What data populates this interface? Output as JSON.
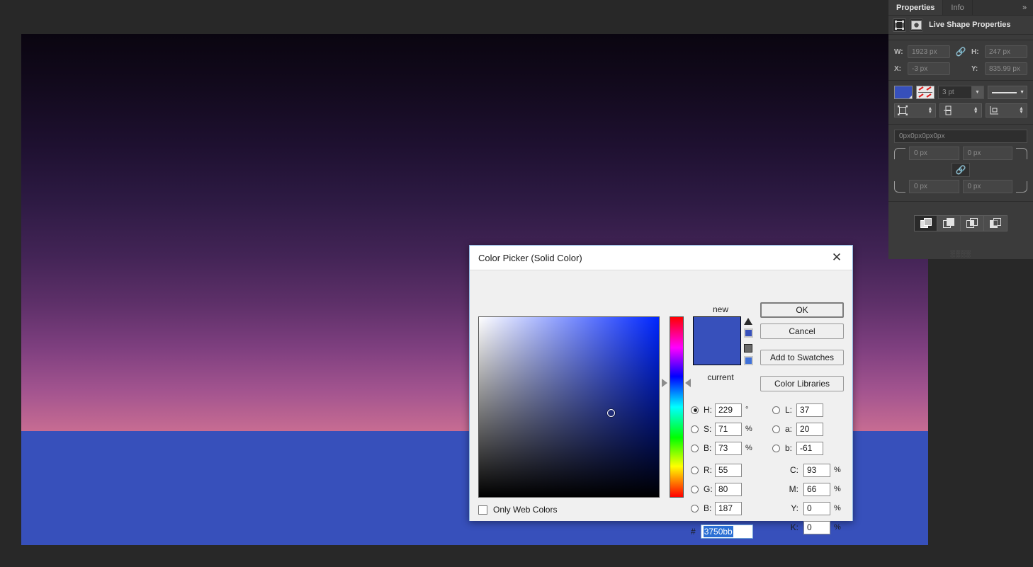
{
  "canvas": {
    "gradient_top_color": "#0a0510",
    "gradient_bottom_color": "#c76c92",
    "shape_color": "#3750bb"
  },
  "properties_panel": {
    "tabs": [
      {
        "label": "Properties",
        "active": true
      },
      {
        "label": "Info",
        "active": false
      }
    ],
    "collapse_icon": "»",
    "title": "Live Shape Properties",
    "dimensions": {
      "w_label": "W:",
      "w_value": "1923 px",
      "h_label": "H:",
      "h_value": "247 px",
      "x_label": "X:",
      "x_value": "-3 px",
      "y_label": "Y:",
      "y_value": "835.99 px",
      "link_icon": "🔗"
    },
    "stroke": {
      "fill_color": "#3750bb",
      "stroke_width": "3 pt"
    },
    "corner_radius": {
      "combined": "0px0px0px0px",
      "top_left": "0 px",
      "top_right": "0 px",
      "bottom_left": "0 px",
      "bottom_right": "0 px",
      "link_icon": "🔗"
    },
    "grip": "░░░░"
  },
  "dialog": {
    "title": "Color Picker (Solid Color)",
    "close_icon": "✕",
    "new_label": "new",
    "current_label": "current",
    "new_color": "#3750bb",
    "buttons": {
      "ok": "OK",
      "cancel": "Cancel",
      "add_to_swatches": "Add to Swatches",
      "color_libraries": "Color Libraries"
    },
    "only_web_colors": {
      "label": "Only Web Colors",
      "checked": false
    },
    "hsb": [
      {
        "label": "H:",
        "value": "229",
        "unit": "°",
        "selected": true
      },
      {
        "label": "S:",
        "value": "71",
        "unit": "%",
        "selected": false
      },
      {
        "label": "B:",
        "value": "73",
        "unit": "%",
        "selected": false
      }
    ],
    "rgb": [
      {
        "label": "R:",
        "value": "55",
        "unit": "",
        "selected": false
      },
      {
        "label": "G:",
        "value": "80",
        "unit": "",
        "selected": false
      },
      {
        "label": "B:",
        "value": "187",
        "unit": "",
        "selected": false
      }
    ],
    "lab": [
      {
        "label": "L:",
        "value": "37",
        "unit": "",
        "selected": false
      },
      {
        "label": "a:",
        "value": "20",
        "unit": "",
        "selected": false
      },
      {
        "label": "b:",
        "value": "-61",
        "unit": "",
        "selected": false
      }
    ],
    "cmyk": [
      {
        "label": "C:",
        "value": "93",
        "unit": "%"
      },
      {
        "label": "M:",
        "value": "66",
        "unit": "%"
      },
      {
        "label": "Y:",
        "value": "0",
        "unit": "%"
      },
      {
        "label": "K:",
        "value": "0",
        "unit": "%"
      }
    ],
    "hex": {
      "prefix": "#",
      "value": "3750bb"
    }
  }
}
